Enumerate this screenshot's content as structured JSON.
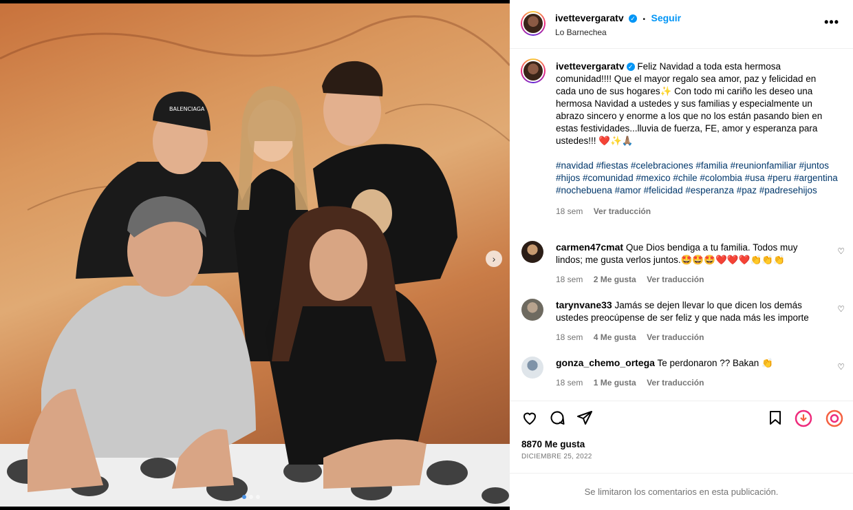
{
  "post": {
    "username": "ivettevergaratv",
    "follow_label": "Seguir",
    "location": "Lo Barnechea",
    "more_label": "•••",
    "caption": "Feliz Navidad a toda esta hermosa comunidad!!!! Que el mayor regalo sea amor, paz y felicidad en cada uno de sus hogares✨ Con todo mi cariño les deseo una hermosa Navidad a ustedes y sus familias y especialmente un abrazo sincero y enorme a los que no los están pasando bien en estas festividades...lluvia de fuerza, FE, amor y esperanza para ustedes!!! ❤️✨🙏🏽",
    "hashtags": "#navidad #fiestas #celebraciones #familia #reunionfamiliar #juntos #hijos #comunidad #mexico #chile #colombia #usa #peru #argentina #nochebuena #amor #felicidad #esperanza #paz #padresehijos",
    "caption_time": "18 sem",
    "caption_translate": "Ver traducción"
  },
  "photo": {
    "cap_text": "BALENCIAGA"
  },
  "comments": [
    {
      "username": "carmen47cmat",
      "text": "Que Dios bendiga a tu familia. Todos muy lindos; me gusta verlos juntos.🤩🤩🤩❤️❤️❤️👏👏👏",
      "time": "18 sem",
      "likes": "2 Me gusta",
      "translate": "Ver traducción"
    },
    {
      "username": "tarynvane33",
      "text": "Jamás se dejen llevar lo que dicen los demás ustedes preocúpense de ser feliz y que nada más les importe",
      "time": "18 sem",
      "likes": "4 Me gusta",
      "translate": "Ver traducción"
    },
    {
      "username": "gonza_chemo_ortega",
      "text": "Te perdonaron ?? Bakan 👏",
      "time": "18 sem",
      "likes": "1 Me gusta",
      "translate": "Ver traducción"
    }
  ],
  "footer": {
    "likes": "8870 Me gusta",
    "date": "DICIEMBRE 25, 2022",
    "limited": "Se limitaron los comentarios en esta publicación."
  },
  "icons": [
    "heart-icon",
    "comment-icon",
    "share-icon",
    "save-icon",
    "reel-icon",
    "remix-icon",
    "verified-icon",
    "next-arrow-icon"
  ],
  "colors": {
    "link": "#0095f6",
    "hashtag": "#00376b",
    "muted": "#737373"
  }
}
